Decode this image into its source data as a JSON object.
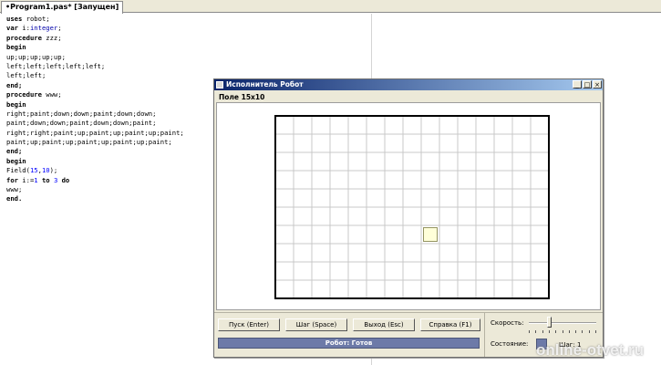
{
  "ide": {
    "tab_label": "•Program1.pas* [Запущен]"
  },
  "code": {
    "lines": [
      [
        {
          "t": "uses",
          "c": "kw"
        },
        {
          "t": " robot;",
          "c": ""
        }
      ],
      [
        {
          "t": "var",
          "c": "kw"
        },
        {
          "t": " i:",
          "c": ""
        },
        {
          "t": "integer",
          "c": "type"
        },
        {
          "t": ";",
          "c": ""
        }
      ],
      [
        {
          "t": "procedure",
          "c": "kw"
        },
        {
          "t": " zzz;",
          "c": ""
        }
      ],
      [
        {
          "t": "begin",
          "c": "kw"
        }
      ],
      [
        {
          "t": "up;up;up;up;up;",
          "c": ""
        }
      ],
      [
        {
          "t": "left;left;left;left;left;",
          "c": ""
        }
      ],
      [
        {
          "t": "left;left;",
          "c": ""
        }
      ],
      [
        {
          "t": "end;",
          "c": "kw"
        }
      ],
      [
        {
          "t": "procedure",
          "c": "kw"
        },
        {
          "t": " www;",
          "c": ""
        }
      ],
      [
        {
          "t": "begin",
          "c": "kw"
        }
      ],
      [
        {
          "t": "right;paint;down;down;paint;down;down;",
          "c": ""
        }
      ],
      [
        {
          "t": "paint;down;down;paint;down;down;paint;",
          "c": ""
        }
      ],
      [
        {
          "t": "right;right;paint;up;paint;up;paint;up;paint;",
          "c": ""
        }
      ],
      [
        {
          "t": "paint;up;paint;up;paint;up;paint;up;paint;",
          "c": ""
        }
      ],
      [
        {
          "t": "end;",
          "c": "kw"
        }
      ],
      [
        {
          "t": "begin",
          "c": "kw"
        }
      ],
      [
        {
          "t": "Field(",
          "c": ""
        },
        {
          "t": "15",
          "c": "num"
        },
        {
          "t": ",",
          "c": ""
        },
        {
          "t": "10",
          "c": "num"
        },
        {
          "t": ");",
          "c": ""
        }
      ],
      [
        {
          "t": "for",
          "c": "kw"
        },
        {
          "t": " i:=",
          "c": ""
        },
        {
          "t": "1",
          "c": "num"
        },
        {
          "t": " ",
          "c": ""
        },
        {
          "t": "to",
          "c": "kw"
        },
        {
          "t": " ",
          "c": ""
        },
        {
          "t": "3",
          "c": "num"
        },
        {
          "t": " ",
          "c": ""
        },
        {
          "t": "do",
          "c": "kw"
        }
      ],
      [
        {
          "t": "www;",
          "c": ""
        }
      ],
      [
        {
          "t": "end.",
          "c": "kw"
        }
      ]
    ]
  },
  "robot_window": {
    "title": "Исполнитель Робот",
    "minimize_label": "_",
    "maximize_label": "□",
    "close_label": "×",
    "field_label": "Поле 15x10",
    "field": {
      "cols": 15,
      "rows": 10,
      "robot_cell": {
        "col": 8,
        "row": 6
      }
    },
    "buttons": {
      "start": "Пуск (Enter)",
      "step": "Шаг (Space)",
      "exit": "Выход (Esc)",
      "help": "Справка (F1)"
    },
    "status": "Робот: Готов",
    "speed_label": "Скорость:",
    "speed_level": 0.3,
    "state_label": "Состояние:",
    "step_label": "Шаг: 1"
  },
  "colors": {
    "titlebar_start": "#0a246a",
    "titlebar_end": "#a6caf0",
    "status_bar": "#6d7aa8",
    "robot_cell": "#ffffd9",
    "grid_line": "#c8c8c8",
    "grid_border": "#000000"
  },
  "watermark": "online-otvet.ru"
}
